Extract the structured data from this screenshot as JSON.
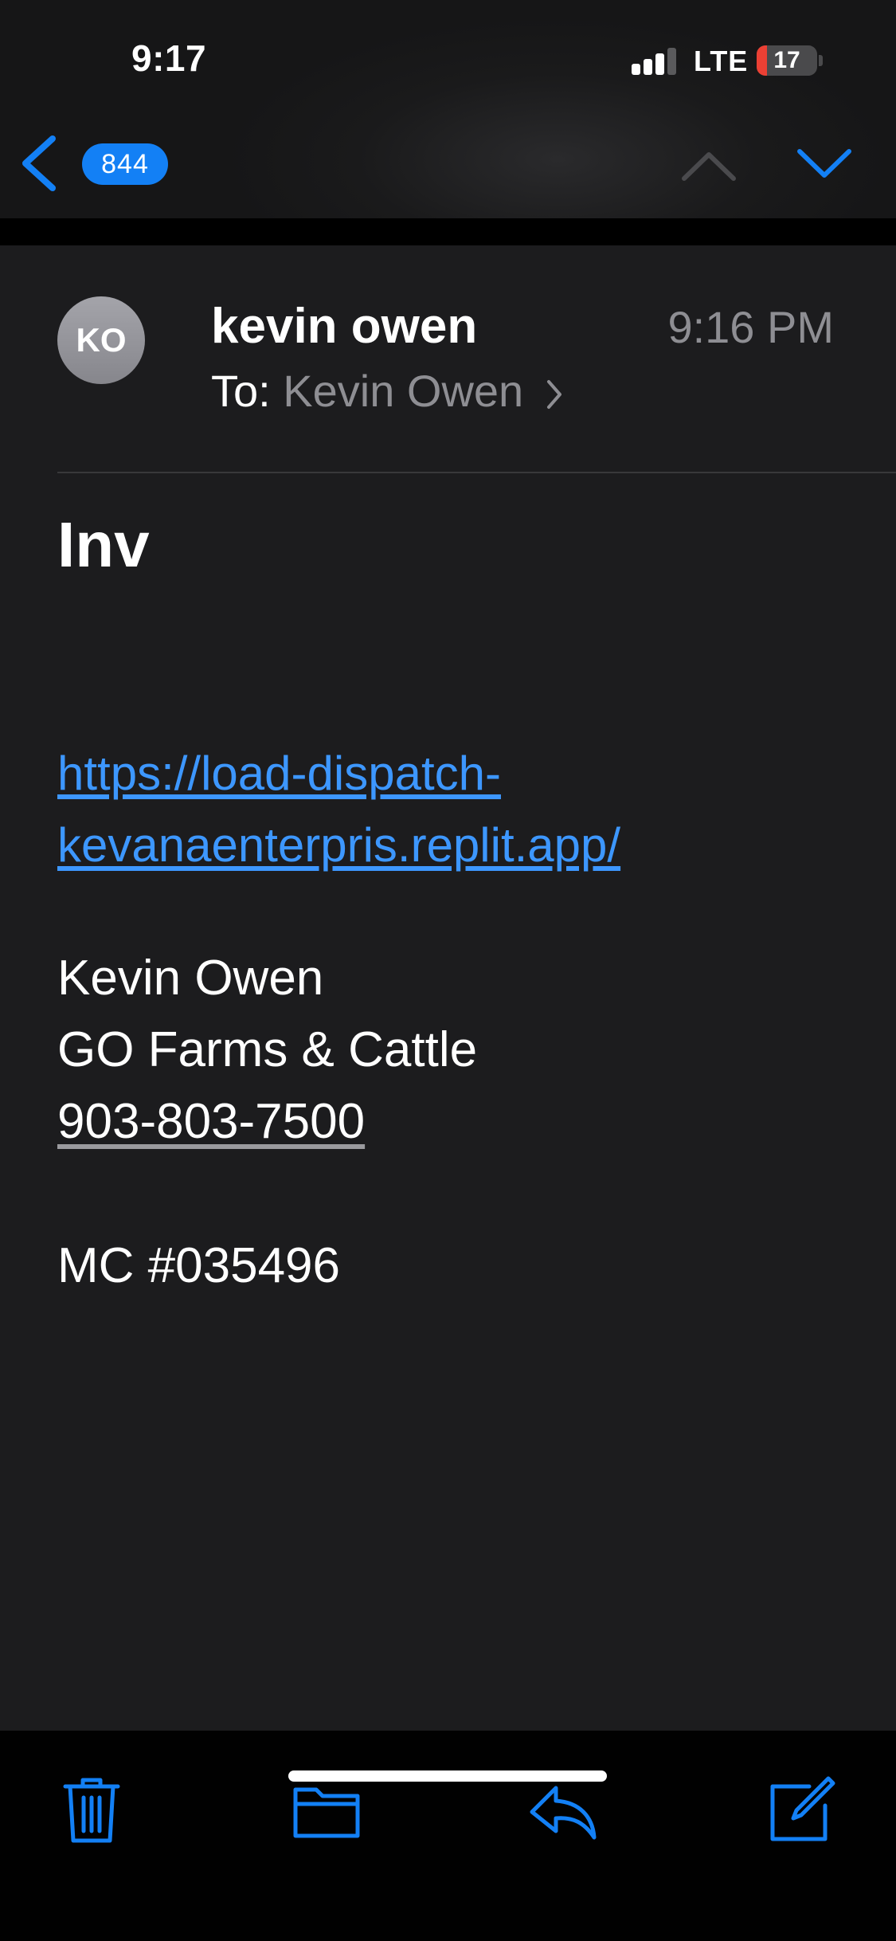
{
  "status_bar": {
    "time": "9:17",
    "network": "LTE",
    "battery_level": "17",
    "battery_fill_percent": 17,
    "signal_bars_active": 3,
    "signal_bars_total": 4
  },
  "nav": {
    "unread_count": "844",
    "icons": {
      "back": "chevron-left-icon",
      "previous": "chevron-up-icon",
      "next": "chevron-down-icon"
    },
    "previous_enabled": false,
    "next_enabled": true
  },
  "message": {
    "avatar_initials": "KO",
    "sender": "kevin owen",
    "time": "9:16 PM",
    "to_label": "To:",
    "to_name": "Kevin Owen",
    "subject": "Inv",
    "link_line1": "https://load-dispatch-",
    "link_line2": "kevanaenterpris.replit.app/",
    "signature": {
      "name": "Kevin Owen",
      "company": "GO Farms & Cattle",
      "phone": "903-803-7500",
      "mc_number": "MC #035496"
    }
  },
  "toolbar": {
    "icons": [
      "trash-icon",
      "folder-icon",
      "reply-icon",
      "compose-icon"
    ]
  },
  "colors": {
    "accent": "#1380f5",
    "link": "#3d97ff",
    "background": "#1c1c1e",
    "secondary_text": "#8e8e93",
    "battery_low": "#eb4034"
  }
}
